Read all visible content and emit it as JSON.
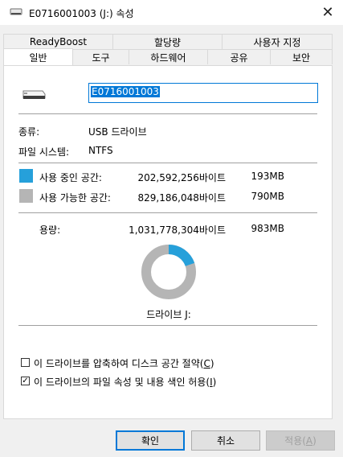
{
  "window": {
    "title": "E0716001003 (J:) 속성",
    "close_glyph": "✕"
  },
  "tabs": {
    "row1": [
      "ReadyBoost",
      "할당량",
      "사용자 지정"
    ],
    "row2": [
      "일반",
      "도구",
      "하드웨어",
      "공유",
      "보안"
    ],
    "active": "일반"
  },
  "general": {
    "drive_name": "E0716001003",
    "type_label": "종류:",
    "type_value": "USB 드라이브",
    "fs_label": "파일 시스템:",
    "fs_value": "NTFS",
    "used": {
      "label": "사용 중인 공간:",
      "bytes": "202,592,256바이트",
      "size": "193MB",
      "color": "#26a0da"
    },
    "free": {
      "label": "사용 가능한 공간:",
      "bytes": "829,186,048바이트",
      "size": "790MB",
      "color": "#b5b5b5"
    },
    "capacity": {
      "label": "용량:",
      "bytes": "1,031,778,304바이트",
      "size": "983MB"
    },
    "used_fraction": 0.1963,
    "drive_caption": "드라이브 J:",
    "compress": {
      "label": "이 드라이브를 압축하여 디스크 공간 절약(",
      "key": "C",
      "end": ")",
      "checked": false
    },
    "index": {
      "label": "이 드라이브의 파일 속성 및 내용 색인 허용(",
      "key": "I",
      "end": ")",
      "checked": true
    }
  },
  "buttons": {
    "ok": "확인",
    "cancel": "취소",
    "apply_label": "적용(",
    "apply_key": "A",
    "apply_end": ")"
  }
}
